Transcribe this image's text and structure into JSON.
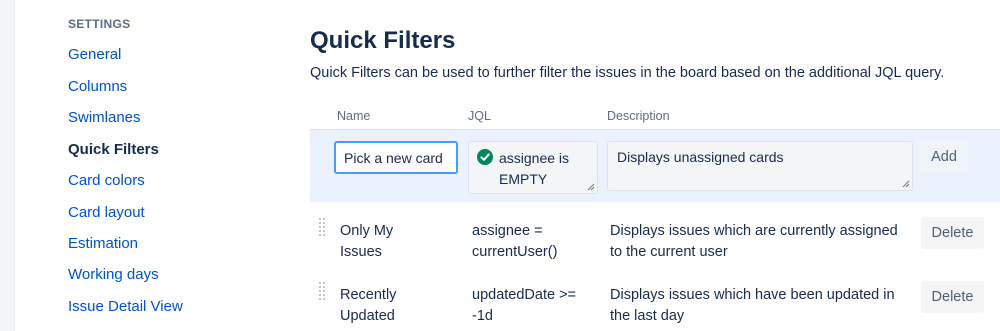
{
  "sidebar": {
    "heading": "SETTINGS",
    "items": [
      {
        "label": "General",
        "active": false
      },
      {
        "label": "Columns",
        "active": false
      },
      {
        "label": "Swimlanes",
        "active": false
      },
      {
        "label": "Quick Filters",
        "active": true
      },
      {
        "label": "Card colors",
        "active": false
      },
      {
        "label": "Card layout",
        "active": false
      },
      {
        "label": "Estimation",
        "active": false
      },
      {
        "label": "Working days",
        "active": false
      },
      {
        "label": "Issue Detail View",
        "active": false
      }
    ]
  },
  "main": {
    "title": "Quick Filters",
    "description": "Quick Filters can be used to further filter the issues in the board based on the additional JQL query.",
    "columns": {
      "name": "Name",
      "jql": "JQL",
      "description": "Description"
    },
    "new_filter": {
      "name_value": "Pick a new card",
      "jql_value": "assignee is EMPTY",
      "jql_status_icon": "check-circle-icon",
      "description_value": "Displays unassigned cards",
      "add_label": "Add"
    },
    "filters": [
      {
        "name": "Only My Issues",
        "jql": "assignee = currentUser()",
        "description": "Displays issues which are currently assigned to the current user",
        "delete_label": "Delete"
      },
      {
        "name": "Recently Updated",
        "jql": "updatedDate >= -1d",
        "description": "Displays issues which have been updated in the last day",
        "delete_label": "Delete"
      }
    ]
  },
  "colors": {
    "link": "#0052cc",
    "text": "#172b4d",
    "subtle": "#5e6c84",
    "add_row_bg": "#ebf2fe",
    "focus_border": "#4c9aff",
    "success": "#00875a"
  }
}
